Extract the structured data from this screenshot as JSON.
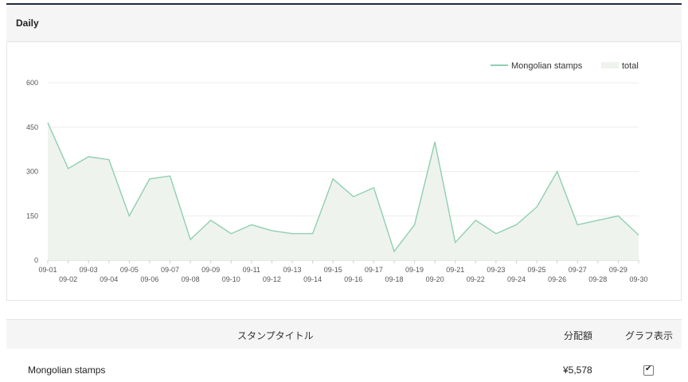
{
  "panel": {
    "title": "Daily"
  },
  "legend": {
    "series_label": "Mongolian stamps",
    "total_label": "total"
  },
  "colors": {
    "line": "#8fcfb0",
    "fill": "#eef3ee",
    "grid": "#ececec"
  },
  "chart_data": {
    "type": "area",
    "x": [
      "09-01",
      "09-02",
      "09-03",
      "09-04",
      "09-05",
      "09-06",
      "09-07",
      "09-08",
      "09-09",
      "09-10",
      "09-11",
      "09-12",
      "09-13",
      "09-14",
      "09-15",
      "09-16",
      "09-17",
      "09-18",
      "09-19",
      "09-20",
      "09-21",
      "09-22",
      "09-23",
      "09-24",
      "09-25",
      "09-26",
      "09-27",
      "09-28",
      "09-29",
      "09-30"
    ],
    "series": [
      {
        "name": "Mongolian stamps",
        "values": [
          465,
          310,
          350,
          340,
          150,
          275,
          285,
          70,
          135,
          90,
          120,
          100,
          90,
          90,
          275,
          215,
          245,
          30,
          120,
          400,
          60,
          135,
          90,
          120,
          180,
          300,
          120,
          135,
          150,
          85
        ]
      }
    ],
    "yticks": [
      0,
      150,
      300,
      450,
      600
    ],
    "ylim": [
      0,
      600
    ],
    "legend_position": "top-right",
    "grid": true
  },
  "table": {
    "headers": {
      "title": "スタンプタイトル",
      "amount": "分配額",
      "graph": "グラフ表示"
    },
    "rows": [
      {
        "title": "Mongolian stamps",
        "amount": "¥5,578",
        "graph_checked": true
      }
    ]
  }
}
